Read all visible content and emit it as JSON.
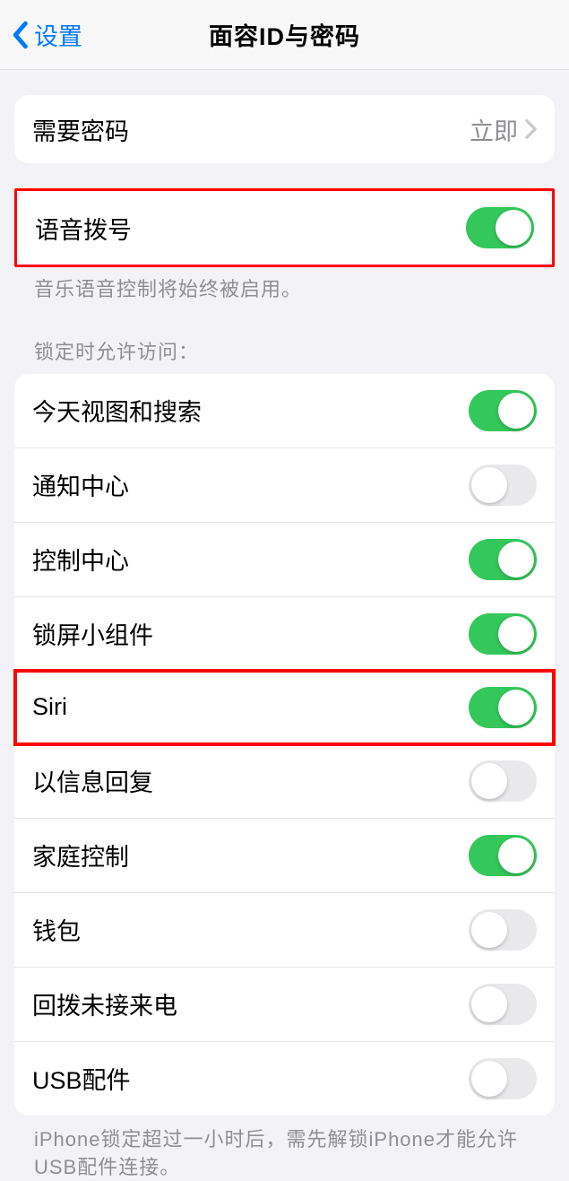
{
  "nav": {
    "back_label": "设置",
    "title": "面容ID与密码"
  },
  "require_passcode": {
    "label": "需要密码",
    "value": "立即"
  },
  "voice_dial": {
    "label": "语音拨号",
    "enabled": true,
    "footer": "音乐语音控制将始终被启用。"
  },
  "allow_access": {
    "header": "锁定时允许访问：",
    "items": [
      {
        "label": "今天视图和搜索",
        "enabled": true
      },
      {
        "label": "通知中心",
        "enabled": false
      },
      {
        "label": "控制中心",
        "enabled": true
      },
      {
        "label": "锁屏小组件",
        "enabled": true
      },
      {
        "label": "Siri",
        "enabled": true
      },
      {
        "label": "以信息回复",
        "enabled": false
      },
      {
        "label": "家庭控制",
        "enabled": true
      },
      {
        "label": "钱包",
        "enabled": false
      },
      {
        "label": "回拨未接来电",
        "enabled": false
      },
      {
        "label": "USB配件",
        "enabled": false
      }
    ],
    "footer": "iPhone锁定超过一小时后，需先解锁iPhone才能允许USB配件连接。"
  }
}
